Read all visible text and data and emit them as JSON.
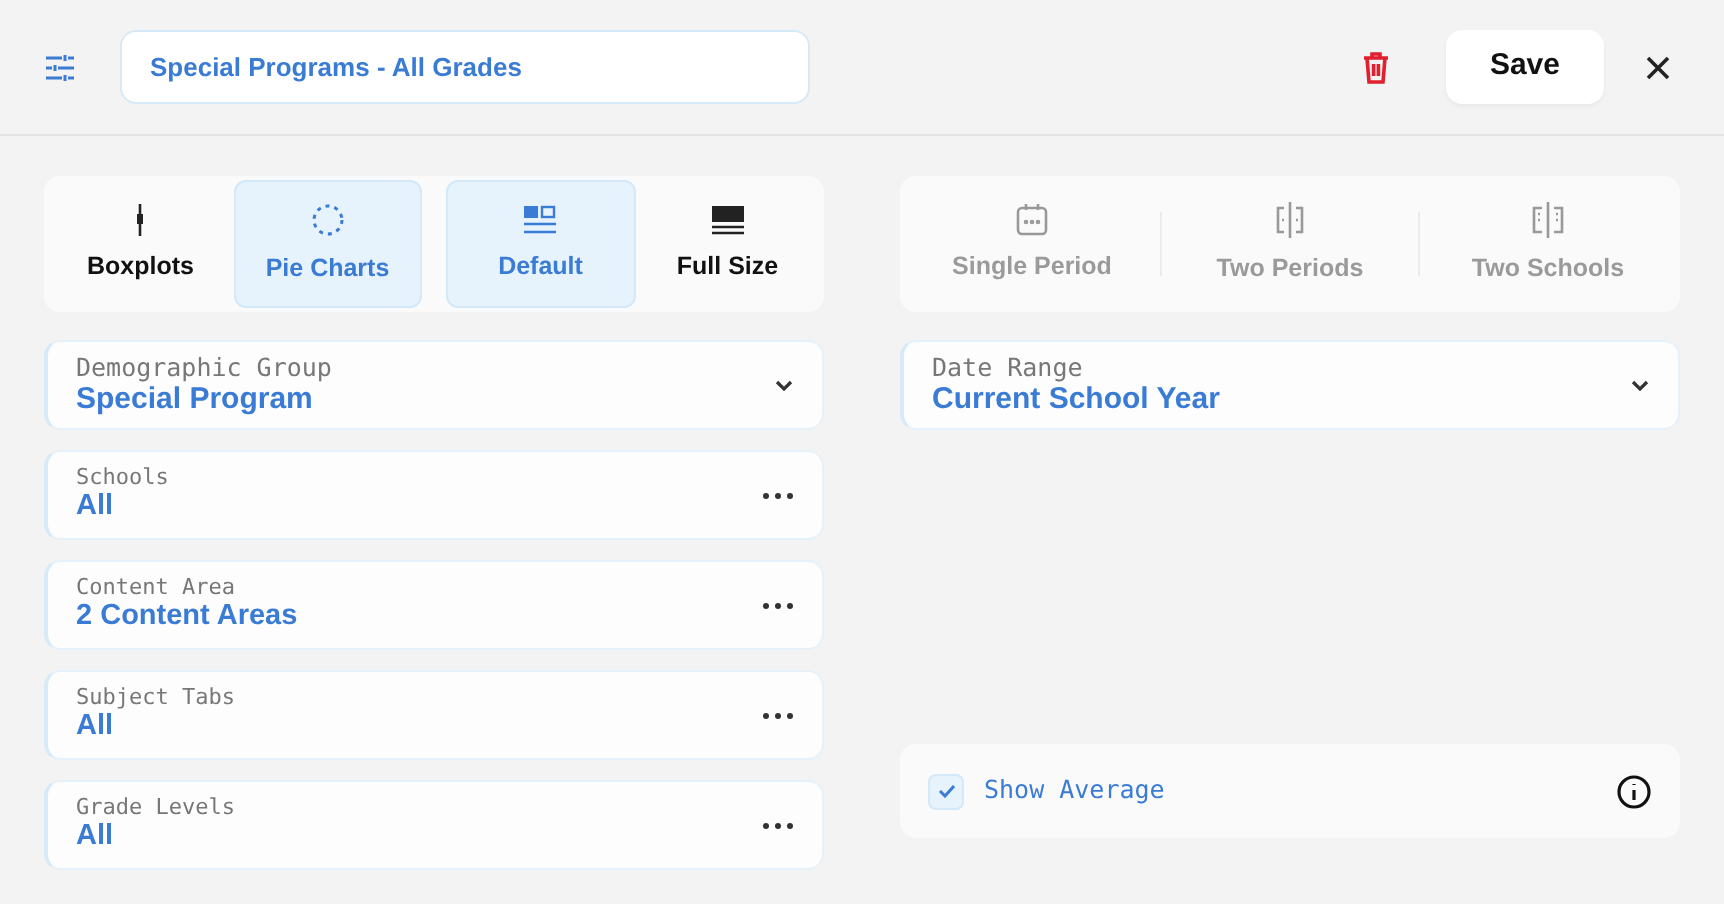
{
  "header": {
    "title": "Special Programs - All Grades",
    "save": "Save"
  },
  "chart_types": [
    {
      "label": "Boxplots",
      "selected": false
    },
    {
      "label": "Pie Charts",
      "selected": true
    }
  ],
  "sizes": [
    {
      "label": "Default",
      "selected": true
    },
    {
      "label": "Full Size",
      "selected": false
    }
  ],
  "comparisons": [
    {
      "label": "Single Period",
      "disabled": true
    },
    {
      "label": "Two Periods",
      "disabled": true
    },
    {
      "label": "Two Schools",
      "disabled": true
    }
  ],
  "filters": [
    {
      "label": "Demographic Group",
      "value": "Special Program",
      "kind": "dropdown"
    },
    {
      "label": "Schools",
      "value": "All",
      "kind": "more"
    },
    {
      "label": "Content Area",
      "value": "2 Content Areas",
      "kind": "more"
    },
    {
      "label": "Subject Tabs",
      "value": "All",
      "kind": "more"
    },
    {
      "label": "Grade Levels",
      "value": "All",
      "kind": "more"
    }
  ],
  "date_range": {
    "label": "Date Range",
    "value": "Current School Year",
    "kind": "dropdown"
  },
  "show_average": {
    "label": "Show Average",
    "checked": true
  }
}
